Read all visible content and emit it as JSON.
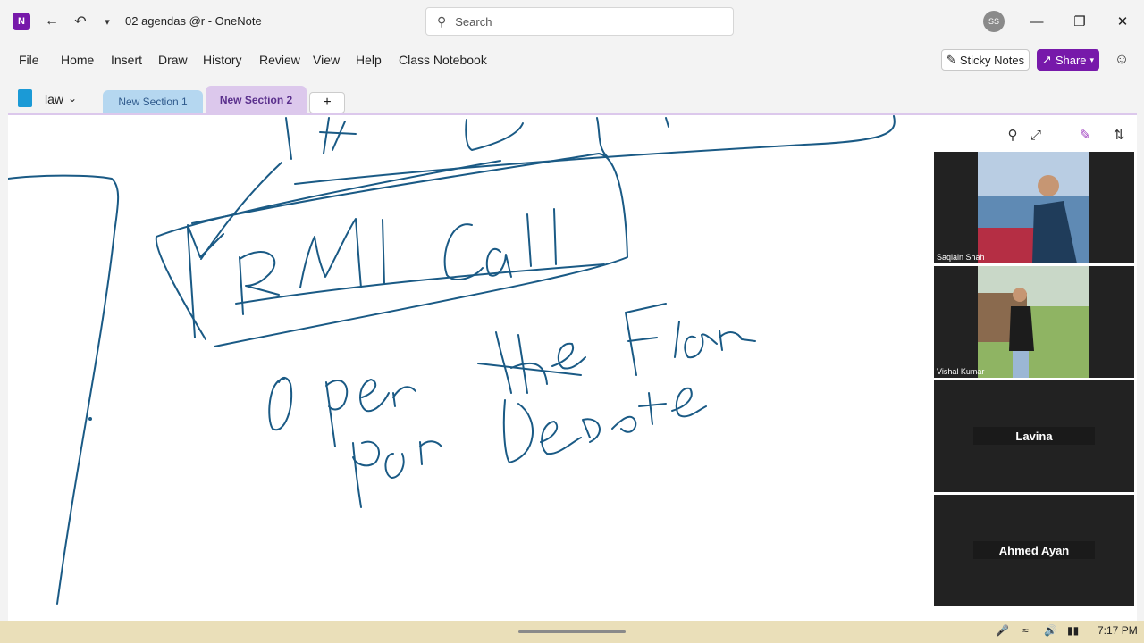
{
  "app": {
    "icon_letter": "N",
    "title": "02 agendas @r  -  OneNote"
  },
  "titlebar": {
    "search_placeholder": "Search",
    "avatar_initials": "SS"
  },
  "menu": {
    "items": [
      "File",
      "Home",
      "Insert",
      "Draw",
      "History",
      "Review",
      "View",
      "Help",
      "Class Notebook"
    ],
    "sticky_notes": "Sticky Notes",
    "share": "Share"
  },
  "notebook": {
    "name": "law",
    "sections": [
      {
        "label": "New Section 1",
        "active": false
      },
      {
        "label": "New Section 2",
        "active": true
      }
    ],
    "add_label": "+"
  },
  "participants": [
    {
      "name": "Saqlain Shah",
      "video": true
    },
    {
      "name": "Vishal Kumar",
      "video": true
    },
    {
      "name": "Lavina",
      "video": false
    },
    {
      "name": "Ahmed Ayan",
      "video": false
    }
  ],
  "taskbar": {
    "time": "7:17 PM"
  },
  "colors": {
    "accent": "#7719aa",
    "ink": "#1a5a85",
    "section1": "#b5d7f0",
    "section2": "#dcc8ec",
    "taskbar": "#eadfb9"
  }
}
